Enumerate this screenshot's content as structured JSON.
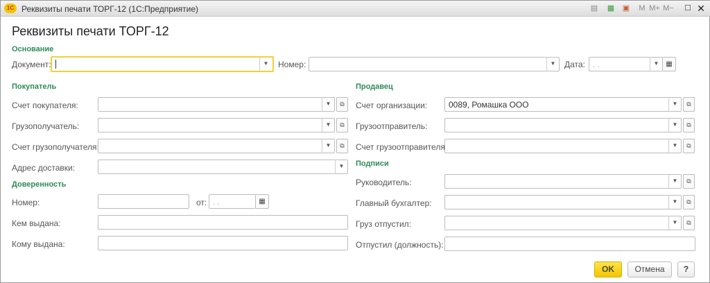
{
  "window": {
    "title": "Реквизиты печати ТОРГ-12  (1С:Предприятие)",
    "logo": "1С",
    "toolbar": [
      "M",
      "M+",
      "M−"
    ]
  },
  "heading": "Реквизиты печати ТОРГ-12",
  "basis": {
    "group": "Основание",
    "document_label": "Документ:",
    "document_value": "",
    "number_label": "Номер:",
    "number_value": "",
    "date_label": "Дата:",
    "date_value": " .  ."
  },
  "buyer": {
    "group": "Покупатель",
    "rows": [
      {
        "label": "Счет покупателя:",
        "value": ""
      },
      {
        "label": "Грузополучатель:",
        "value": ""
      },
      {
        "label": "Счет грузополучателя:",
        "value": ""
      },
      {
        "label": "Адрес доставки:",
        "value": ""
      }
    ]
  },
  "proxy": {
    "group": "Доверенность",
    "number_label": "Номер:",
    "number_value": "",
    "from_label": "от:",
    "from_value": " .  .",
    "issued_by_label": "Кем выдана:",
    "issued_by_value": "",
    "issued_to_label": "Кому выдана:",
    "issued_to_value": ""
  },
  "seller": {
    "group": "Продавец",
    "rows": [
      {
        "label": "Счет организации:",
        "value": "0089, Ромашка ООО"
      },
      {
        "label": "Грузоотправитель:",
        "value": ""
      },
      {
        "label": "Счет грузоотправителя:",
        "value": ""
      }
    ]
  },
  "signatures": {
    "group": "Подписи",
    "rows": [
      {
        "label": "Руководитель:",
        "value": ""
      },
      {
        "label": "Главный бухгалтер:",
        "value": ""
      },
      {
        "label": "Груз отпустил:",
        "value": ""
      },
      {
        "label": "Отпустил (должность):",
        "value": ""
      }
    ]
  },
  "buttons": {
    "ok": "OK",
    "cancel": "Отмена",
    "help": "?"
  }
}
